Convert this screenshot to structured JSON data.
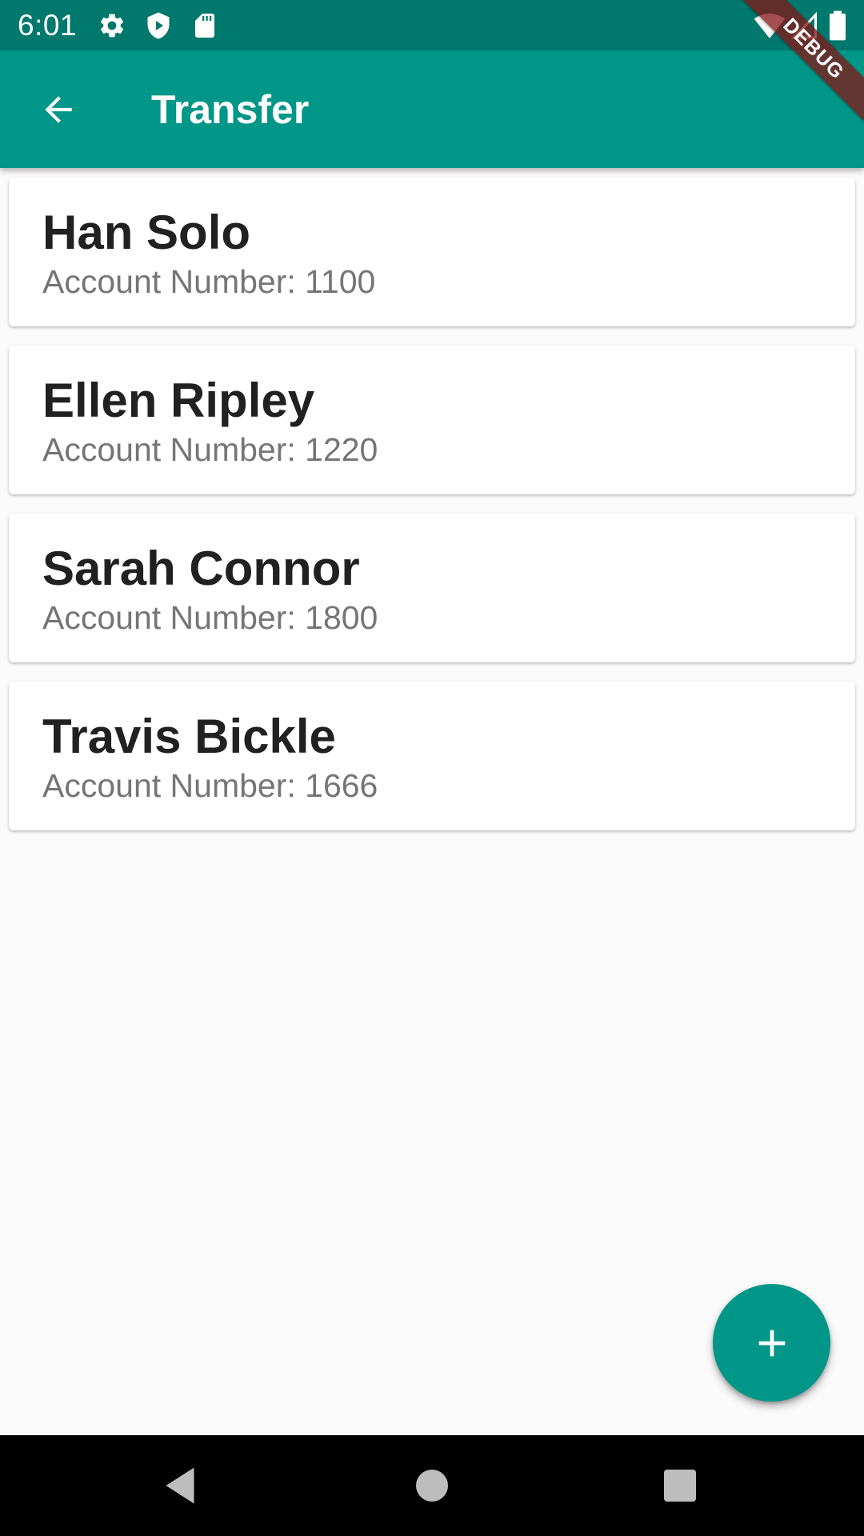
{
  "status_bar": {
    "time": "6:01",
    "left_icons": [
      "settings-icon",
      "shield-icon",
      "sd-card-icon"
    ],
    "right_icons": [
      "wifi-icon",
      "signal-icon",
      "battery-icon"
    ],
    "background": "#00786e"
  },
  "app_bar": {
    "title": "Transfer",
    "back_icon": "arrow-back-icon",
    "background": "#009688"
  },
  "debug_banner": {
    "label": "DEBUG"
  },
  "contacts": [
    {
      "name": "Han Solo",
      "account": "Account Number: 1100"
    },
    {
      "name": "Ellen Ripley",
      "account": "Account Number: 1220"
    },
    {
      "name": "Sarah Connor",
      "account": "Account Number: 1800"
    },
    {
      "name": "Travis Bickle",
      "account": "Account Number: 1666"
    }
  ],
  "fab": {
    "icon": "plus-icon",
    "background": "#009688"
  },
  "nav_bar": {
    "buttons": [
      "nav-back-icon",
      "nav-home-icon",
      "nav-recents-icon"
    ]
  }
}
